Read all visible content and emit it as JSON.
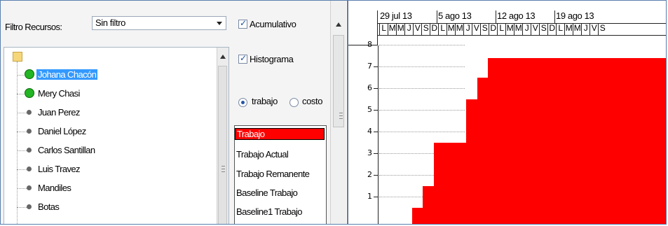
{
  "resources_panel": {
    "filter_label": "Filtro Recursos:",
    "filter_value": "Sin filtro",
    "tree": [
      {
        "name": "Johana Chacón",
        "status": "assigned",
        "selected": true
      },
      {
        "name": "Mery Chasi",
        "status": "assigned",
        "selected": false
      },
      {
        "name": "Juan Perez",
        "status": "unassigned",
        "selected": false
      },
      {
        "name": "Daniel López",
        "status": "unassigned",
        "selected": false
      },
      {
        "name": "Carlos Santillan",
        "status": "unassigned",
        "selected": false
      },
      {
        "name": "Luis Travez",
        "status": "unassigned",
        "selected": false
      },
      {
        "name": "Mandiles",
        "status": "unassigned",
        "selected": false
      },
      {
        "name": "Botas",
        "status": "unassigned",
        "selected": false
      }
    ]
  },
  "options": {
    "cumulative": {
      "label": "Acumulativo",
      "checked": true
    },
    "histogram": {
      "label": "Histograma",
      "checked": true
    },
    "radio": [
      {
        "label": "trabajo",
        "selected": true
      },
      {
        "label": "costo",
        "selected": false
      }
    ],
    "fields": [
      {
        "label": "Trabajo",
        "selected": true
      },
      {
        "label": "Trabajo Actual",
        "selected": false
      },
      {
        "label": "Trabajo Remanente",
        "selected": false
      },
      {
        "label": "Baseline Trabajo",
        "selected": false
      },
      {
        "label": "Baseline1 Trabajo",
        "selected": false
      }
    ]
  },
  "timeline": {
    "weeks": [
      "29 jul 13",
      "5 ago 13",
      "12 ago 13",
      "19 ago 13"
    ],
    "day_letters": [
      "L",
      "M",
      "M",
      "J",
      "V",
      "S",
      "D",
      "L",
      "M",
      "M",
      "J",
      "V",
      "S",
      "D",
      "L",
      "M",
      "M",
      "J",
      "V",
      "S",
      "D",
      "L",
      "M",
      "M",
      "J",
      "V",
      "S"
    ]
  },
  "chart_data": {
    "type": "area",
    "y_ticks": [
      "1",
      "2",
      "3",
      "4",
      "5",
      "6",
      "7",
      "8"
    ],
    "ylim": [
      0,
      8
    ],
    "bar_color": "#ff0000",
    "series": [
      {
        "values": [
          {
            "start_day": 3,
            "value": 1
          },
          {
            "start_day": 4,
            "value": 2
          },
          {
            "start_day": 5,
            "value": 4
          },
          {
            "start_day": 8,
            "value": 6
          },
          {
            "start_day": 9,
            "value": 7
          },
          {
            "start_day": 10,
            "value": 8
          }
        ]
      }
    ]
  },
  "colors": {
    "assigned_dot": "#23b523",
    "selection": "#3399ff",
    "field_selected": "#ff0000"
  }
}
